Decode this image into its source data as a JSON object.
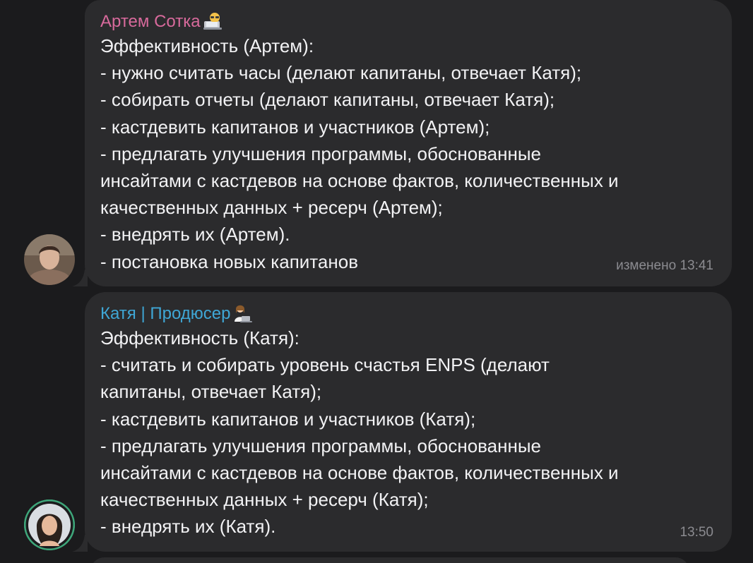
{
  "messages": [
    {
      "sender": "Артем Сотка",
      "sender_color": "#d86a9c",
      "sender_emoji_icon": "laptop-face-emoji-icon",
      "text": "Эффективность (Артем):\n- нужно считать часы (делают капитаны, отвечает Катя);\n- собирать отчеты (делают капитаны, отвечает Катя);\n- кастдевить капитанов и участников (Артем);\n- предлагать улучшения программы, обоснованные\nинсайтами с кастдевов на основе фактов, количественных и\nкачественных данных + ресерч (Артем);\n- внедрять их (Артем).\n- постановка новых капитанов",
      "meta": "изменено 13:41",
      "avatar_icon": "user-avatar-artem"
    },
    {
      "sender": "Катя | Продюсер",
      "sender_color": "#3fa7d6",
      "sender_emoji_icon": "woman-laptop-emoji-icon",
      "text": "Эффективность (Катя):\n- считать и собирать уровень счастья ENPS (делают\nкапитаны, отвечает Катя);\n- кастдевить капитанов и участников (Катя);\n- предлагать улучшения программы, обоснованные\nинсайтами с кастдевов на основе фактов, количественных и\nкачественных данных + ресерч (Катя);\n- внедрять их (Катя).",
      "meta": "13:50",
      "avatar_icon": "user-avatar-katya"
    }
  ],
  "colors": {
    "background": "#1b1b1d",
    "bubble": "#2b2b2d",
    "text": "#f2f2f4",
    "meta": "#8b8b90",
    "story_ring": "#3ea67a"
  }
}
